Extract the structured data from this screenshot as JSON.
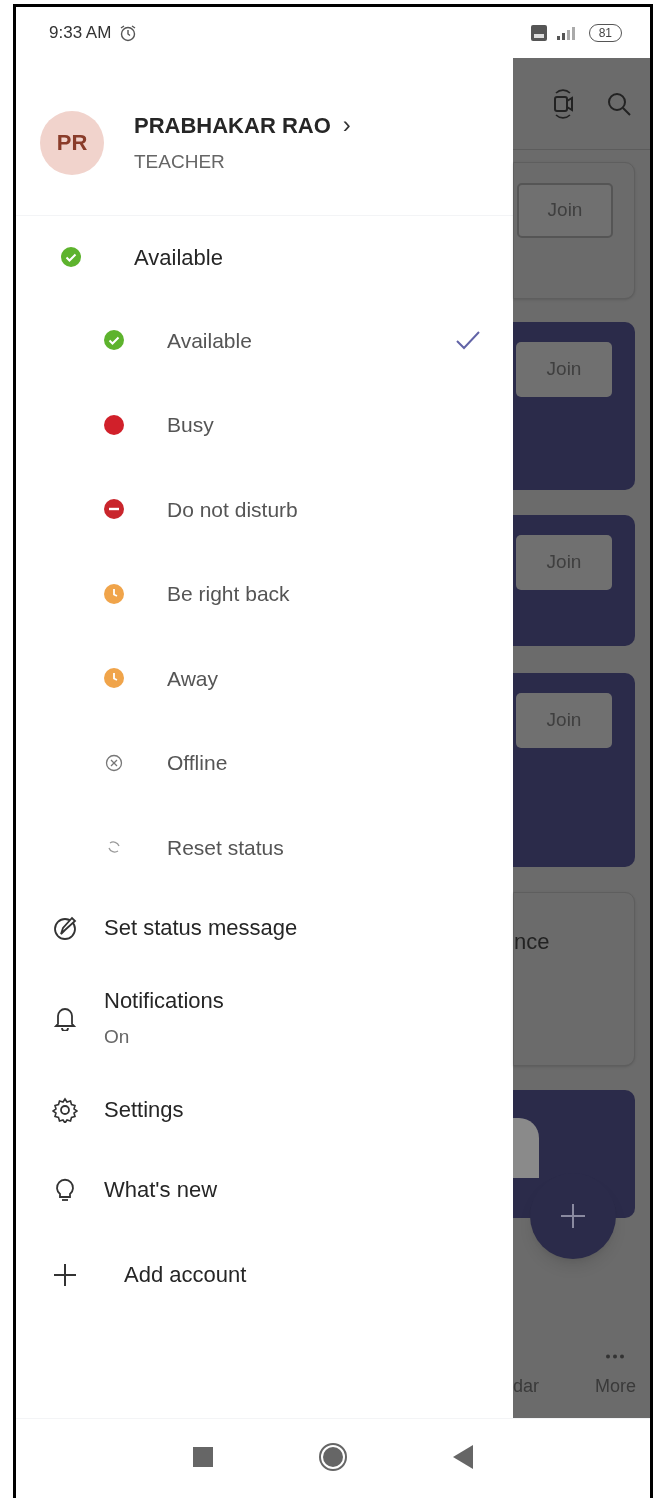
{
  "status_bar": {
    "time": "9:33 AM",
    "battery": "81"
  },
  "profile": {
    "initials": "PR",
    "name": "PRABHAKAR RAO",
    "chevron": "›",
    "role": "TEACHER"
  },
  "current_status": {
    "label": "Available",
    "color": "#5db32d"
  },
  "status_options": [
    {
      "kind": "available",
      "label": "Available",
      "color": "#5db32d",
      "selected": true
    },
    {
      "kind": "busy",
      "label": "Busy",
      "color": "#d1202a",
      "selected": false
    },
    {
      "kind": "dnd",
      "label": "Do not disturb",
      "color": "#c9252c",
      "selected": false
    },
    {
      "kind": "brb",
      "label": "Be right back",
      "color": "#f0a44a",
      "selected": false
    },
    {
      "kind": "away",
      "label": "Away",
      "color": "#f0a44a",
      "selected": false
    },
    {
      "kind": "offline",
      "label": "Offline",
      "selected": false
    },
    {
      "kind": "reset",
      "label": "Reset status",
      "selected": false
    }
  ],
  "menu": [
    {
      "kind": "status_message",
      "label": "Set status message"
    },
    {
      "kind": "notifications",
      "label": "Notifications",
      "sub": "On"
    },
    {
      "kind": "settings",
      "label": "Settings"
    },
    {
      "kind": "whats_new",
      "label": "What's new"
    },
    {
      "kind": "add_account",
      "label": "Add account"
    }
  ],
  "background": {
    "cards": [
      {
        "kind": "light",
        "button": "Join"
      },
      {
        "kind": "dark",
        "button": "Join"
      },
      {
        "kind": "dark",
        "button": "Join"
      },
      {
        "kind": "dark",
        "button": "Join"
      },
      {
        "kind": "light",
        "text": "nce"
      },
      {
        "kind": "dark"
      }
    ],
    "tabs": [
      "dar",
      "More"
    ]
  }
}
